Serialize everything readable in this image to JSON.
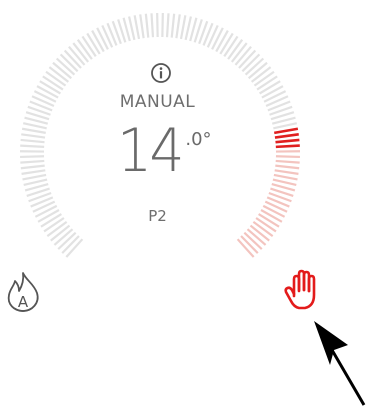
{
  "thermostat": {
    "mode": "MANUAL",
    "temperature_integer": "14",
    "temperature_decimal": ".0°",
    "program": "P2",
    "dial_level_fraction": 0.22
  },
  "icons": {
    "info": "info-icon",
    "auto_mode": "auto-flame-icon",
    "manual_mode": "manual-hand-icon",
    "pointer": "arrow-pointer"
  },
  "colors": {
    "tick_inactive": "#e2e2e2",
    "tick_active": "#f3c4bf",
    "tick_highlight": "#e02020",
    "manual_icon": "#e31b1b",
    "text": "#6b6b6b"
  }
}
